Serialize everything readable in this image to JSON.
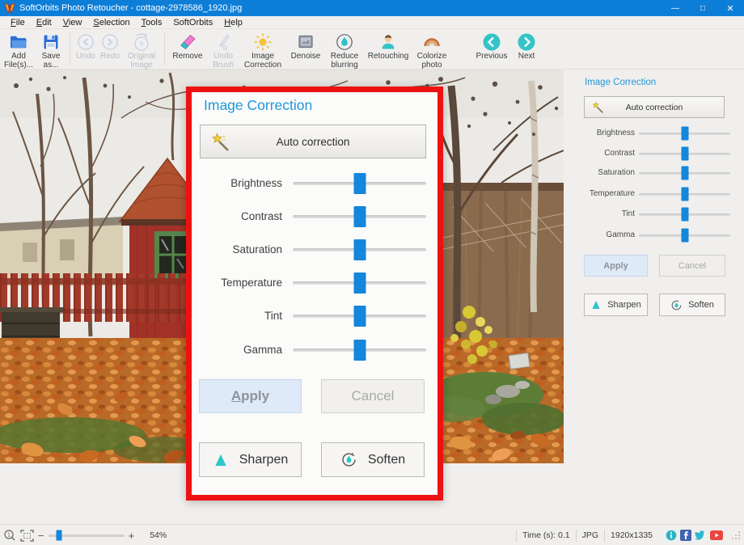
{
  "window": {
    "title": "SoftOrbits Photo Retoucher - cottage-2978586_1920.jpg"
  },
  "icons": {
    "minimize": "—",
    "maximize": "□",
    "close": "✕"
  },
  "menu": {
    "items": [
      {
        "label": "File"
      },
      {
        "label": "Edit"
      },
      {
        "label": "View"
      },
      {
        "label": "Selection"
      },
      {
        "label": "Tools"
      },
      {
        "label": "SoftOrbits"
      },
      {
        "label": "Help"
      }
    ]
  },
  "toolbar": {
    "items": [
      {
        "label": "Add File(s)...",
        "icon": "folder-icon",
        "enabled": true
      },
      {
        "label": "Save as...",
        "icon": "floppy-icon",
        "enabled": true
      },
      {
        "label": "Undo",
        "icon": "undo-icon",
        "enabled": false
      },
      {
        "label": "Redo",
        "icon": "redo-icon",
        "enabled": false
      },
      {
        "label": "Original Image",
        "icon": "original-image-icon",
        "enabled": false
      },
      {
        "label": "Remove",
        "icon": "eraser-icon",
        "enabled": true
      },
      {
        "label": "Undo Brush",
        "icon": "brush-icon",
        "enabled": false
      },
      {
        "label": "Image Correction",
        "icon": "sun-icon",
        "enabled": true
      },
      {
        "label": "Denoise",
        "icon": "photo-icon",
        "enabled": true
      },
      {
        "label": "Reduce blurring",
        "icon": "droplet-icon",
        "enabled": true
      },
      {
        "label": "Retouching",
        "icon": "person-icon",
        "enabled": true
      },
      {
        "label": "Colorize photo",
        "icon": "rainbow-icon",
        "enabled": true
      },
      {
        "label": "Previous",
        "icon": "prev-circle-icon",
        "enabled": true
      },
      {
        "label": "Next",
        "icon": "next-circle-icon",
        "enabled": true
      }
    ]
  },
  "correction": {
    "title": "Image Correction",
    "auto_button": "Auto correction",
    "sliders": [
      {
        "label": "Brightness",
        "value": 50
      },
      {
        "label": "Contrast",
        "value": 50
      },
      {
        "label": "Saturation",
        "value": 50
      },
      {
        "label": "Temperature",
        "value": 50
      },
      {
        "label": "Tint",
        "value": 50
      },
      {
        "label": "Gamma",
        "value": 50
      }
    ],
    "apply": "Apply",
    "cancel": "Cancel",
    "sharpen": "Sharpen",
    "soften": "Soften"
  },
  "statusbar": {
    "minus": "−",
    "plus": "+",
    "zoom_percent": "54%",
    "zoom_value": 14,
    "time": "Time (s): 0.1",
    "format": "JPG",
    "dimensions": "1920x1335",
    "social": [
      "info",
      "facebook",
      "twitter",
      "youtube"
    ]
  },
  "colors": {
    "titlebar_blue": "#0d7ed8",
    "callout_red": "#ee1111",
    "slider_blue": "#1486db",
    "heading_blue": "#2496d8",
    "teal_accent": "#2dc2c7"
  }
}
